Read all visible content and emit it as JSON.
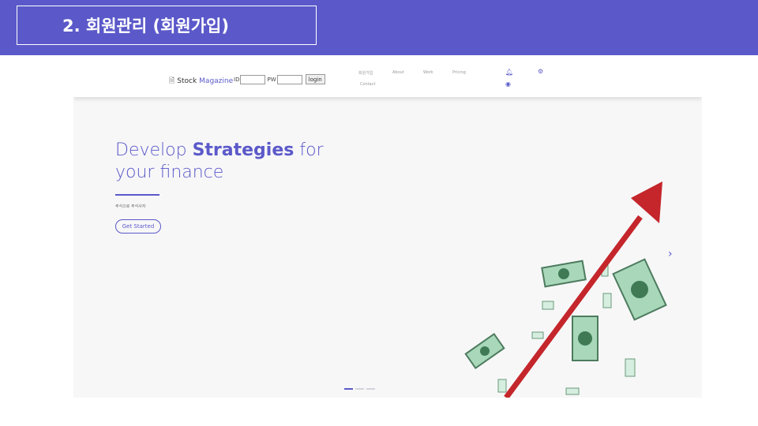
{
  "slide": {
    "title": "2. 회원관리 (회원가입)",
    "accent_color": "#5b59c9"
  },
  "navbar": {
    "brand_icon": "document-icon",
    "brand_prefix": "Stock",
    "brand_highlight": "Magazine",
    "id_label": "ID",
    "id_value": "",
    "pw_label": "PW",
    "pw_value": "",
    "login_label": "login",
    "links": {
      "signup": "회원가입",
      "about": "About",
      "work": "Work",
      "pricing": "Pricing",
      "contact": "Contact"
    },
    "icons": [
      "bell-icon",
      "gear-icon",
      "user-circle-icon"
    ]
  },
  "hero": {
    "title_prefix": "Develop ",
    "title_bold": "Strategies",
    "title_suffix": " for",
    "title_line2": "your finance",
    "subtitle": "주식으로 주식사자",
    "cta_label": "Get Started",
    "next_arrow": "›",
    "illustration": "money-growth-arrow-illustration",
    "slides_total": 3,
    "slide_active": 1
  }
}
